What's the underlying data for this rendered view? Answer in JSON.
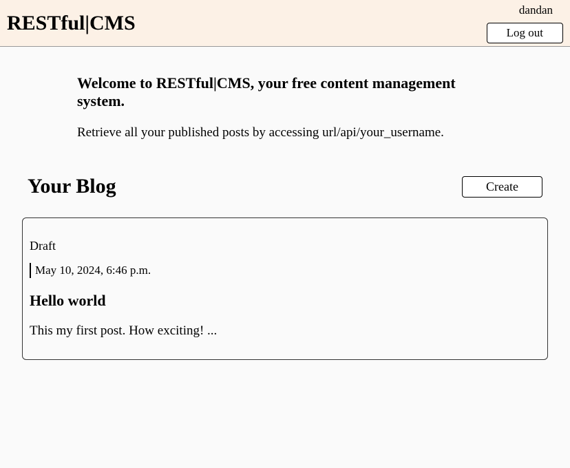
{
  "header": {
    "site_title": "RESTful|CMS",
    "username": "dandan",
    "logout_label": "Log out"
  },
  "intro": {
    "heading": "Welcome to RESTful|CMS, your free content management system.",
    "text": "Retrieve all your published posts by accessing url/api/your_username."
  },
  "blog": {
    "title": "Your Blog",
    "create_label": "Create"
  },
  "posts": [
    {
      "status": "Draft",
      "date": "May 10, 2024, 6:46 p.m.",
      "title": "Hello world",
      "excerpt": "This my first post. How exciting! ..."
    }
  ]
}
